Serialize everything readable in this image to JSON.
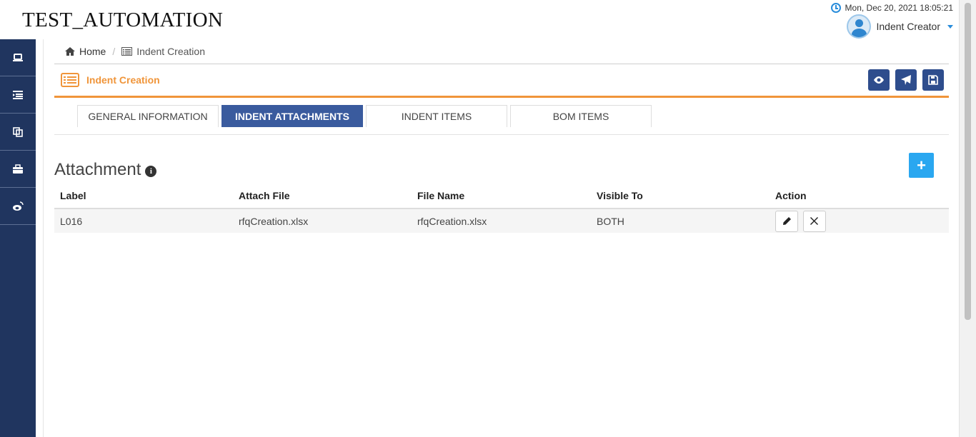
{
  "app": {
    "brand": "TEST_AUTOMATION"
  },
  "header": {
    "datetime": "Mon, Dec 20, 2021 18:05:21",
    "user_name": "Indent Creator"
  },
  "sidebar": {
    "items": [
      {
        "icon": "laptop-icon"
      },
      {
        "icon": "indent-list-icon"
      },
      {
        "icon": "copy-icon"
      },
      {
        "icon": "briefcase-icon"
      },
      {
        "icon": "weibo-icon"
      }
    ]
  },
  "breadcrumb": {
    "home": "Home",
    "current": "Indent Creation"
  },
  "page": {
    "title": "Indent Creation",
    "accent_color": "#f0953a",
    "header_buttons": [
      "eye-icon",
      "send-icon",
      "save-icon"
    ]
  },
  "tabs": [
    {
      "label": "GENERAL INFORMATION",
      "active": false
    },
    {
      "label": "INDENT ATTACHMENTS",
      "active": true
    },
    {
      "label": "INDENT ITEMS",
      "active": false
    },
    {
      "label": "BOM ITEMS",
      "active": false
    }
  ],
  "attachments": {
    "title": "Attachment",
    "add_label": "+",
    "columns": [
      "Label",
      "Attach File",
      "File Name",
      "Visible To",
      "Action"
    ],
    "rows": [
      {
        "label": "L016",
        "attach_file": "rfqCreation.xlsx",
        "file_name": "rfqCreation.xlsx",
        "visible_to": "BOTH"
      }
    ]
  }
}
